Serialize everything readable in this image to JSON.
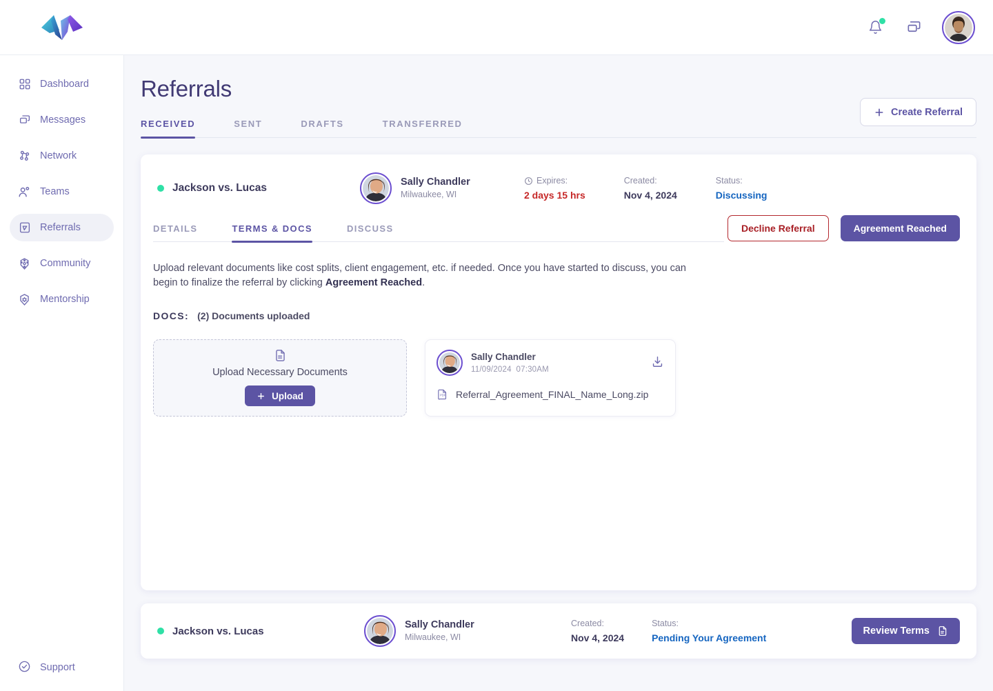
{
  "brand": {
    "logo_name": "logo-mark",
    "accent": "#5c54a4",
    "green": "#2fe0a6"
  },
  "topbar": {
    "notifications_icon": "bell-icon",
    "messages_icon": "chat-icon",
    "avatar_name": "user-avatar"
  },
  "sidebar": {
    "items": [
      {
        "label": "Dashboard",
        "icon": "grid-icon",
        "active": false
      },
      {
        "label": "Messages",
        "icon": "chat-icon",
        "active": false
      },
      {
        "label": "Network",
        "icon": "network-icon",
        "active": false
      },
      {
        "label": "Teams",
        "icon": "users-icon",
        "active": false
      },
      {
        "label": "Referrals",
        "icon": "referral-icon",
        "active": true
      },
      {
        "label": "Community",
        "icon": "community-icon",
        "active": false
      },
      {
        "label": "Mentorship",
        "icon": "mentorship-icon",
        "active": false
      }
    ],
    "support": {
      "label": "Support",
      "icon": "check-circle-icon"
    }
  },
  "page": {
    "title": "Referrals",
    "tabs": [
      {
        "label": "RECEIVED",
        "active": true
      },
      {
        "label": "SENT",
        "active": false
      },
      {
        "label": "DRAFTS",
        "active": false
      },
      {
        "label": "TRANSFERRED",
        "active": false
      }
    ],
    "create_button": "Create Referral"
  },
  "referral": {
    "case_title": "Jackson vs. Lucas",
    "person": {
      "name": "Sally Chandler",
      "location": "Milwaukee, WI"
    },
    "meta": {
      "expires_label": "Expires:",
      "expires_value": "2 days 15 hrs",
      "created_label": "Created:",
      "created_value": "Nov 4, 2024",
      "status_label": "Status:",
      "status_value": "Discussing"
    },
    "subtabs": [
      {
        "label": "DETAILS",
        "active": false
      },
      {
        "label": "TERMS & DOCS",
        "active": true
      },
      {
        "label": "DISCUSS",
        "active": false
      }
    ],
    "decline_button": "Decline Referral",
    "agree_button": "Agreement Reached",
    "body_text_1": "Upload relevant documents like cost splits, client engagement, etc. if needed. Once you have started to discuss, you can begin to finalize the referral by clicking ",
    "body_text_bold": "Agreement Reached",
    "body_text_2": ".",
    "docs_label": "DOCS:",
    "docs_count": "(2) Documents uploaded",
    "upload": {
      "text": "Upload Necessary Documents",
      "button": "Upload",
      "icon": "document-icon"
    },
    "document": {
      "uploader": "Sally Chandler",
      "date": "11/09/2024",
      "time": "07:30AM",
      "filename": "Referral_Agreement_FINAL_Name_Long.zip",
      "file_icon": "pdf-file-icon",
      "download_icon": "download-icon"
    }
  },
  "referral_bottom": {
    "case_title": "Jackson vs. Lucas",
    "person": {
      "name": "Sally Chandler",
      "location": "Milwaukee, WI"
    },
    "created_label": "Created:",
    "created_value": "Nov 4, 2024",
    "status_label": "Status:",
    "status_value": "Pending Your Agreement",
    "review_button": "Review Terms",
    "review_icon": "document-icon"
  }
}
